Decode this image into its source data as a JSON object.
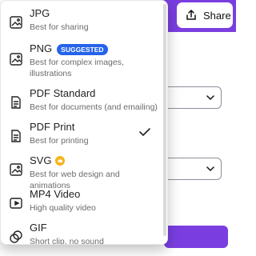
{
  "share": {
    "label": "Share"
  },
  "menu": {
    "items": [
      {
        "title": "JPG",
        "desc": "Best for sharing",
        "icon": "image-icon"
      },
      {
        "title": "PNG",
        "badge": "SUGGESTED",
        "desc": "Best for complex images, illustrations",
        "icon": "image-icon"
      },
      {
        "title": "PDF Standard",
        "desc": "Best for documents (and emailing)",
        "icon": "document-icon"
      },
      {
        "title": "PDF Print",
        "desc": "Best for printing",
        "icon": "document-icon",
        "selected": true
      },
      {
        "title": "SVG",
        "desc": "Best for web design and animations",
        "icon": "image-icon",
        "premium": true
      },
      {
        "title": "MP4 Video",
        "desc": "High quality video",
        "icon": "video-icon"
      },
      {
        "title": "GIF",
        "desc": "Short clip, no sound",
        "icon": "gif-icon"
      }
    ]
  }
}
